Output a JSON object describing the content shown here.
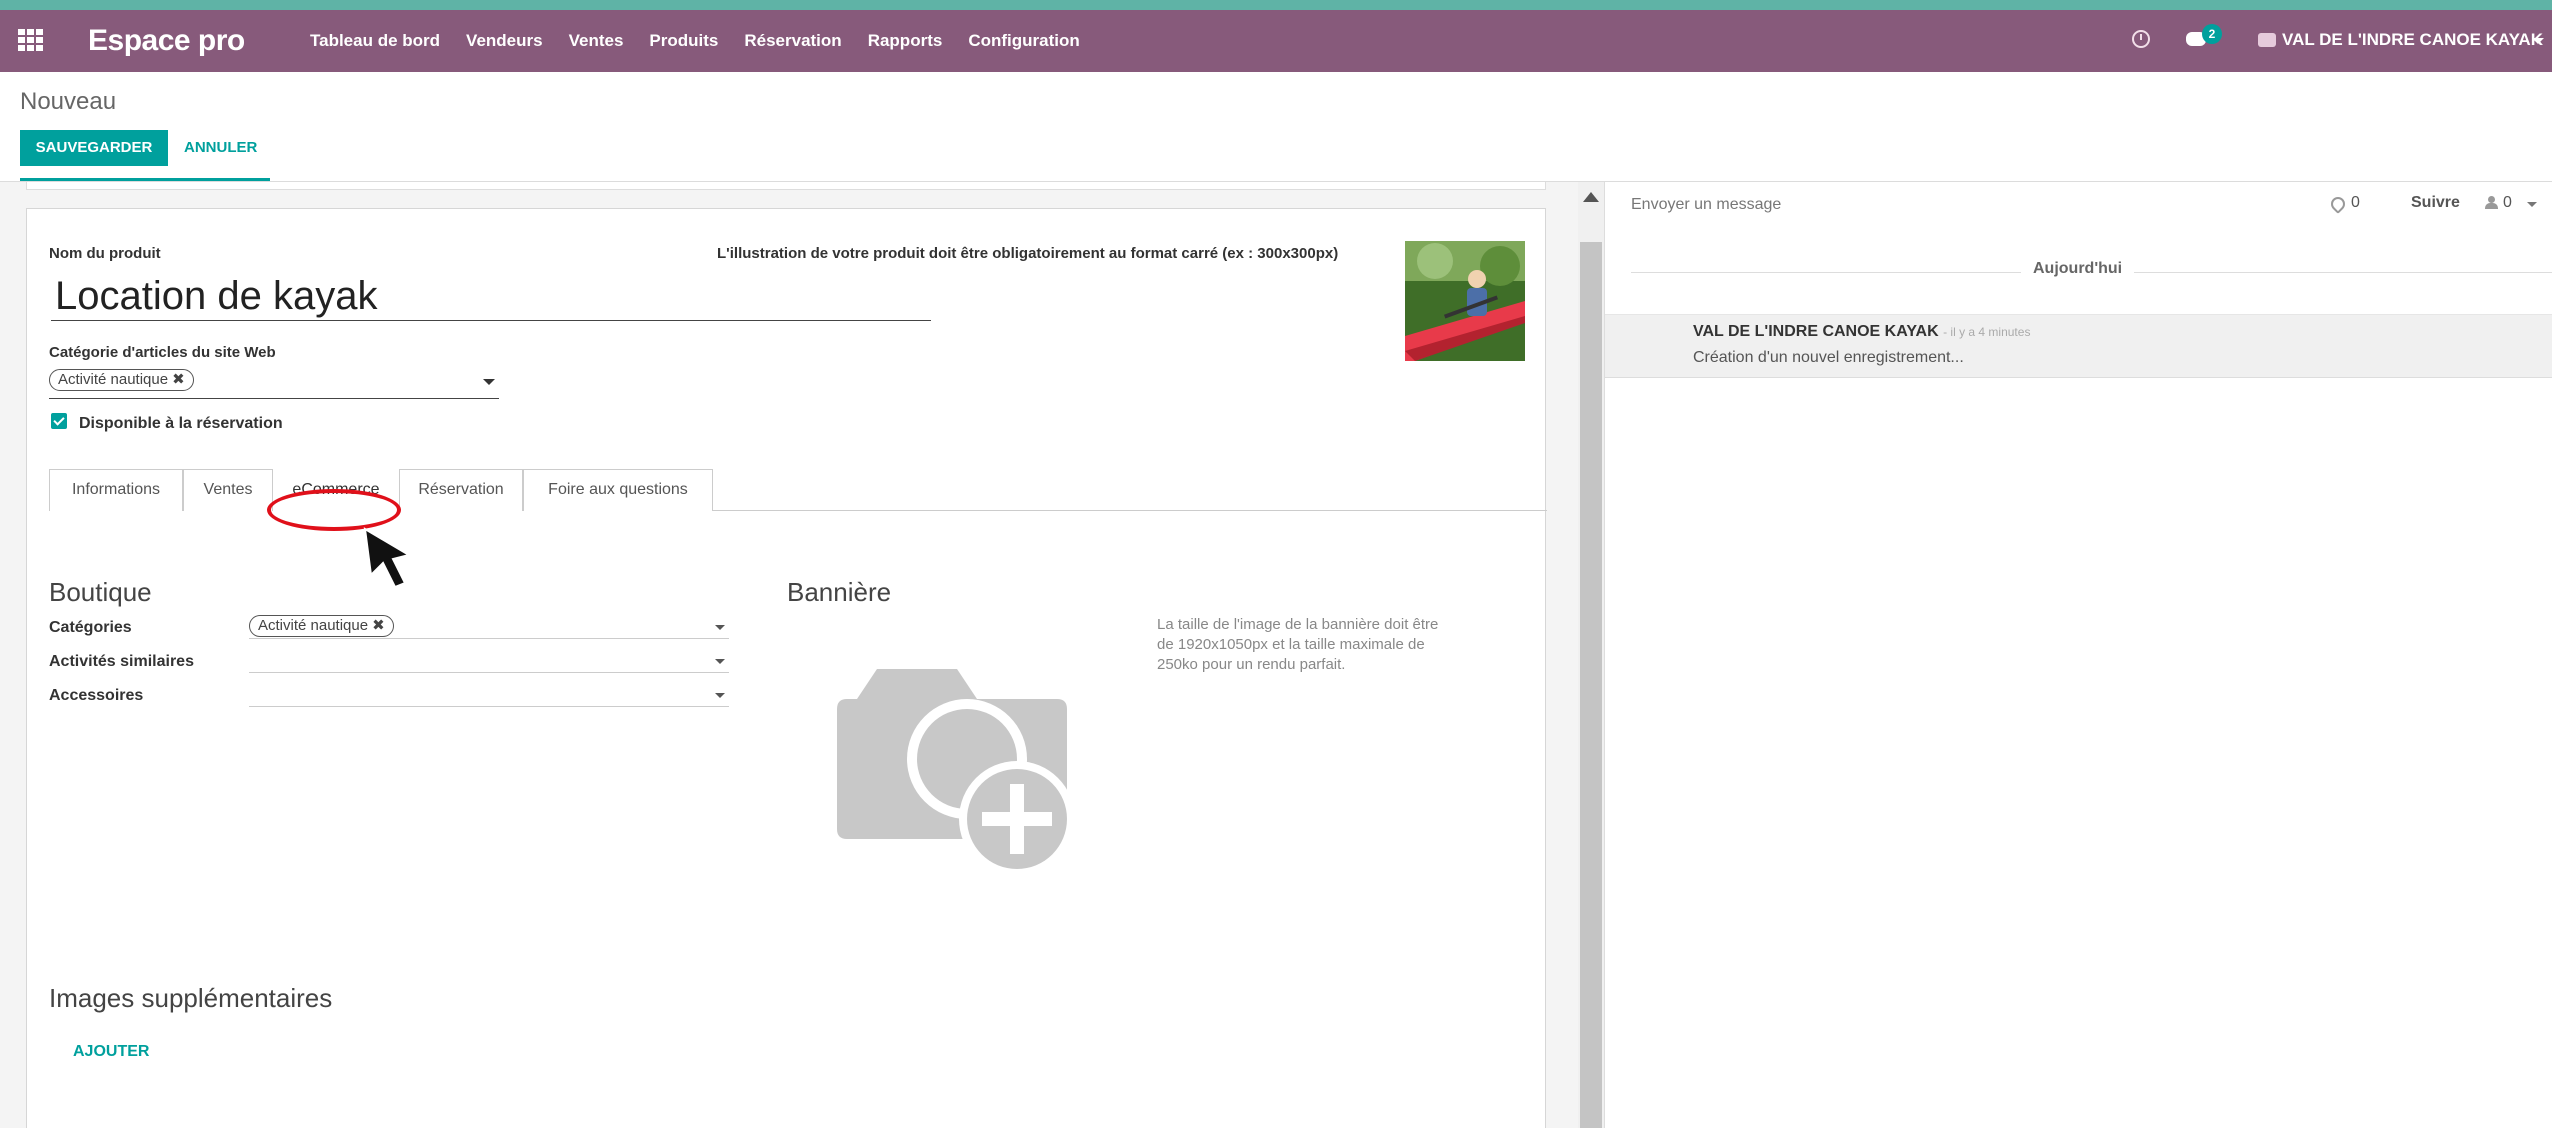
{
  "navbar": {
    "brand": "Espace pro",
    "menu": [
      "Tableau de bord",
      "Vendeurs",
      "Ventes",
      "Produits",
      "Réservation",
      "Rapports",
      "Configuration"
    ],
    "chat_badge": "2",
    "company": "VAL DE L'INDRE CANOE KAYAK",
    "accent_color": "#875a7b"
  },
  "control": {
    "breadcrumb": "Nouveau",
    "save_label": "SAUVEGARDER",
    "cancel_label": "ANNULER",
    "primary_color": "#00a09d"
  },
  "form": {
    "name_label": "Nom du produit",
    "name_value": "Location de kayak",
    "web_category_label": "Catégorie d'articles du site Web",
    "web_category_tag": "Activité nautique",
    "available_label": "Disponible à la réservation",
    "available_checked": true,
    "illustration_label": "L'illustration de votre produit doit être obligatoirement au format carré (ex : 300x300px)"
  },
  "tabs": [
    {
      "label": "Informations",
      "active": false
    },
    {
      "label": "Ventes",
      "active": false
    },
    {
      "label": "eCommerce",
      "active": true
    },
    {
      "label": "Réservation",
      "active": false
    },
    {
      "label": "Foire aux questions",
      "active": false
    }
  ],
  "ecommerce": {
    "boutique_title": "Boutique",
    "categories_label": "Catégories",
    "categories_tag": "Activité nautique",
    "similar_label": "Activités similaires",
    "accessories_label": "Accessoires",
    "banner_title": "Bannière",
    "banner_help": "La taille de l'image de la bannière doit être de 1920x1050px et la taille maximale de 250ko pour un rendu parfait.",
    "extra_images_title": "Images supplémentaires",
    "add_label": "AJOUTER"
  },
  "chatter": {
    "send_message": "Envoyer un message",
    "attachments": "0",
    "follow": "Suivre",
    "followers": "0",
    "day": "Aujourd'hui",
    "message": {
      "author": "VAL DE L'INDRE CANOE KAYAK",
      "time": "- il y a 4 minutes",
      "body": "Création d'un nouvel enregistrement..."
    }
  }
}
